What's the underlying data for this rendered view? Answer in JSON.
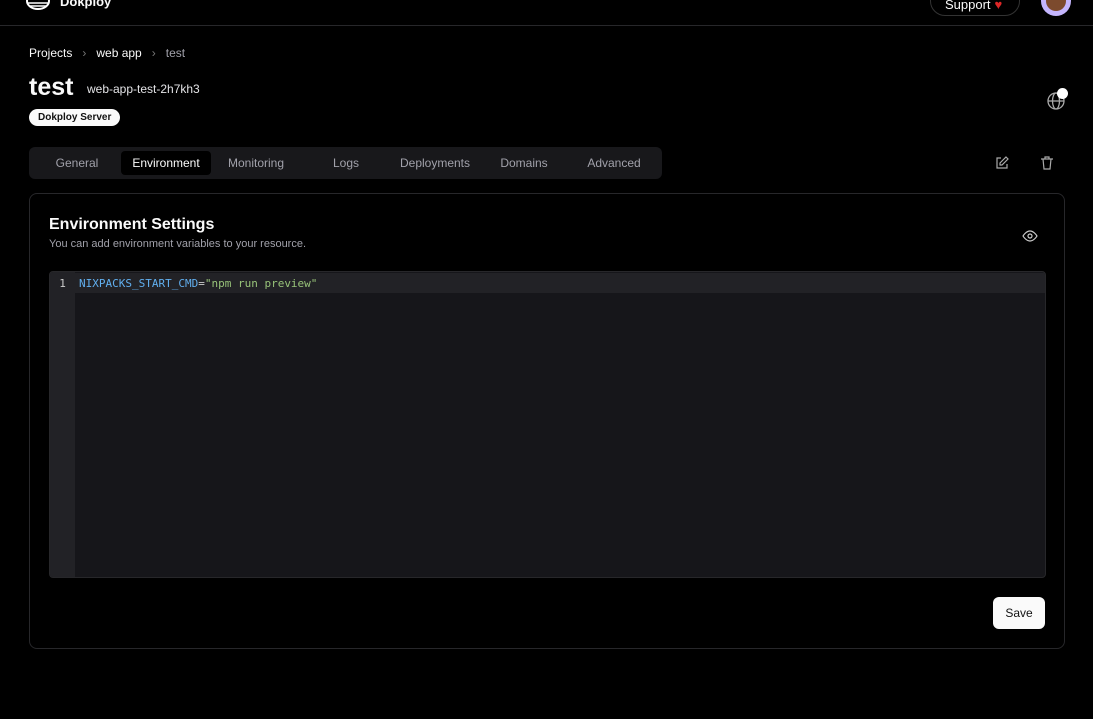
{
  "header": {
    "brand": "Dokploy",
    "support_label": "Support"
  },
  "breadcrumb": [
    "Projects",
    "web app",
    "test"
  ],
  "service": {
    "title": "test",
    "app_name": "web-app-test-2h7kh3",
    "server_badge": "Dokploy Server"
  },
  "tabs": [
    {
      "label": "General"
    },
    {
      "label": "Environment",
      "active": true
    },
    {
      "label": "Monitoring"
    },
    {
      "label": "Logs"
    },
    {
      "label": "Deployments"
    },
    {
      "label": "Domains"
    },
    {
      "label": "Advanced"
    }
  ],
  "env": {
    "title": "Environment Settings",
    "description": "You can add environment variables to your resource.",
    "line_number": "1",
    "key": "NIXPACKS_START_CMD",
    "eq": "=",
    "value": "\"npm run preview\"",
    "save_label": "Save"
  }
}
